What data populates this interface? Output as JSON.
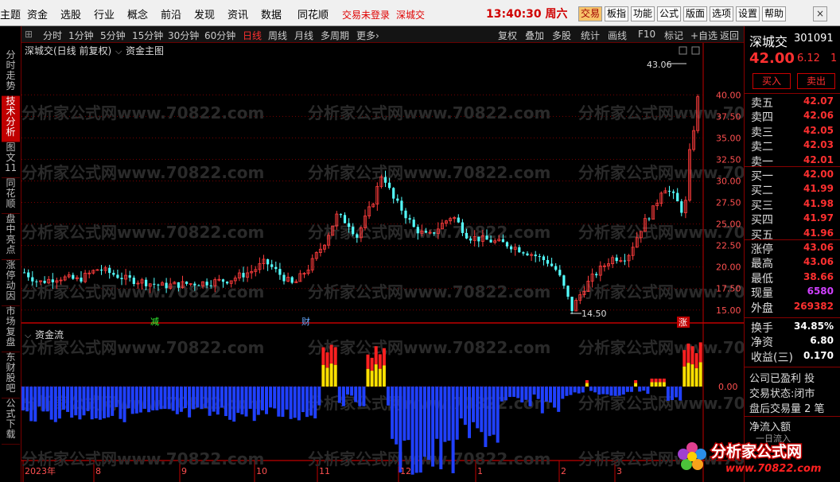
{
  "menu": {
    "items": [
      "主题",
      "资金",
      "选股",
      "行业",
      "概念",
      "前沿",
      "发现",
      "资讯",
      "数据",
      "同花顺"
    ],
    "login_status": "交易未登录",
    "stock": "深城交",
    "clock": "13:40:30",
    "weekday": "周六",
    "buttons": [
      "交易",
      "板指",
      "功能",
      "公式",
      "版面",
      "选项",
      "设置",
      "帮助"
    ],
    "close": "×"
  },
  "leftnav": [
    "分时走势",
    "技术分析",
    "图文11",
    "同花顺",
    "盘中亮点",
    "涨停动因",
    "市场复盘",
    "东财股吧",
    "公式下载"
  ],
  "periods": {
    "items": [
      "分时",
      "1分钟",
      "5分钟",
      "15分钟",
      "30分钟",
      "60分钟",
      "日线",
      "周线",
      "月线",
      "多周期",
      "更多"
    ],
    "active": "日线",
    "more_arrow": "›"
  },
  "tools": [
    "复权",
    "叠加",
    "多股",
    "统计",
    "画线",
    "F10",
    "标记",
    "+自选",
    "返回"
  ],
  "chart": {
    "main_title": "深城交(日线 前复权)",
    "main_indicator": "资金主图",
    "sub_indicator": "资金流",
    "y_ticks": [
      "40.00",
      "37.50",
      "35.00",
      "32.50",
      "30.00",
      "27.50",
      "25.00",
      "22.50",
      "20.00",
      "17.50",
      "15.00"
    ],
    "sub_y_tick": "0.00",
    "high_label": "43.06",
    "low_label": "14.50",
    "events": [
      "减",
      "财",
      "涨"
    ],
    "x_ticks": [
      "2023年",
      "8",
      "9",
      "10",
      "11",
      "12",
      "1",
      "2",
      "3"
    ],
    "watermark": "分析家公式网www.70822.com"
  },
  "chart_data": {
    "type": "candlestick",
    "ylim": [
      13.5,
      44
    ],
    "high": 43.06,
    "low": 14.5
  },
  "quote": {
    "name": "深城交",
    "code": "301091",
    "price": "42.00",
    "change": "6.12",
    "change_suffix": "1",
    "buy_label": "买入",
    "sell_label": "卖出",
    "asks": [
      {
        "label": "卖五",
        "price": "42.07"
      },
      {
        "label": "卖四",
        "price": "42.06"
      },
      {
        "label": "卖三",
        "price": "42.05"
      },
      {
        "label": "卖二",
        "price": "42.03"
      },
      {
        "label": "卖一",
        "price": "42.01"
      }
    ],
    "bids": [
      {
        "label": "买一",
        "price": "42.00"
      },
      {
        "label": "买二",
        "price": "41.99"
      },
      {
        "label": "买三",
        "price": "41.98"
      },
      {
        "label": "买四",
        "price": "41.97"
      },
      {
        "label": "买五",
        "price": "41.96"
      }
    ],
    "stats": [
      {
        "label": "涨停",
        "value": "43.06"
      },
      {
        "label": "最高",
        "value": "43.06"
      },
      {
        "label": "最低",
        "value": "38.66"
      },
      {
        "label": "现量",
        "value": "6580"
      },
      {
        "label": "外盘",
        "value": "269382"
      }
    ],
    "stats2": [
      {
        "label": "换手",
        "value": "34.85%"
      },
      {
        "label": "净资",
        "value": "6.80"
      },
      {
        "label": "收益(三)",
        "value": "0.170"
      }
    ],
    "info": [
      "公司已盈利 投",
      "交易状态:闭市",
      "盘后交易量 2 笔"
    ],
    "flow_label": "净流入额",
    "flow_sub": "一日流入"
  },
  "logo": {
    "text": "分析家公式网",
    "url": "www.70822.com"
  },
  "colors": {
    "up": "#ff3c3c",
    "down": "#54ffff",
    "inflow": "#ff2020",
    "yellow": "#ffe000",
    "outflow": "#2040ff",
    "grid": "#7a0000"
  }
}
